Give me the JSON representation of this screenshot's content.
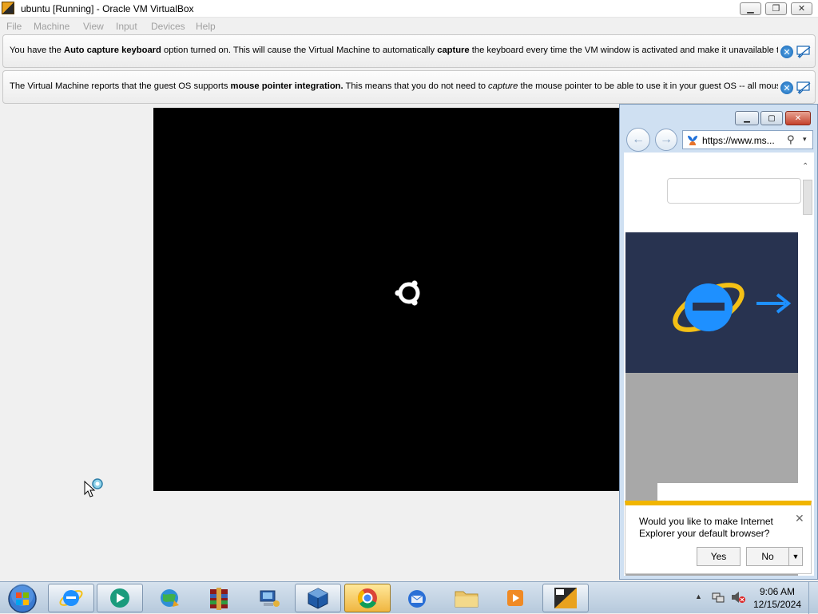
{
  "window": {
    "title": "ubuntu [Running] - Oracle VM VirtualBox",
    "minimize_icon": "minimize-icon",
    "maximize_icon": "restore-icon",
    "close_icon": "close-icon"
  },
  "menu": [
    "File",
    "Machine",
    "View",
    "Input",
    "Devices",
    "Help"
  ],
  "notices": [
    {
      "pre": "You have the ",
      "bold1": "Auto capture keyboard",
      "mid": " option turned on. This will cause the Virtual Machine to automatically ",
      "bold2": "capture",
      "post": " the keyboard every time the VM window is activated and make it unavailable to"
    },
    {
      "pre": "The Virtual Machine reports that the guest OS supports ",
      "bold1": "mouse pointer integration.",
      "mid": " This means that you do not need to ",
      "italic": "capture",
      "post": " the mouse pointer to be able to use it in your guest OS -- all mouse"
    }
  ],
  "ie": {
    "url": "https://www.ms...",
    "back_icon": "back-arrow-icon",
    "forward_icon": "forward-arrow-icon",
    "search_icon": "search-icon"
  },
  "dialog": {
    "message": "Would you like to make Internet Explorer your default browser?",
    "yes": "Yes",
    "no": "No"
  },
  "taskbar": {
    "items": [
      "internet-explorer",
      "media-player",
      "globe-download",
      "winrar",
      "network-computer",
      "virtualbox",
      "chrome",
      "thunderbird",
      "file-explorer",
      "media-app",
      "virtualbox-vm"
    ],
    "time": "9:06 AM",
    "date": "12/15/2024"
  },
  "colors": {
    "vm_bg": "#000000",
    "hero_bg": "#283350",
    "dialog_accent": "#f1b500",
    "ie_blue": "#1e90ff"
  }
}
